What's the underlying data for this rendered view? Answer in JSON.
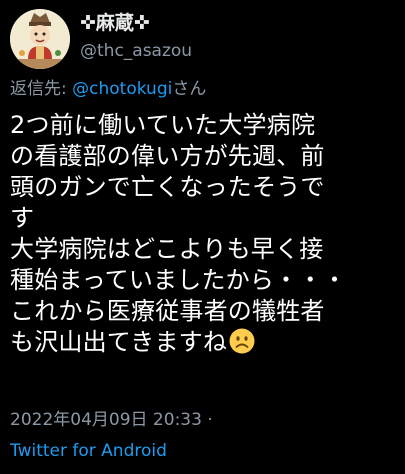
{
  "author": {
    "display_name": "✜麻蔵✜",
    "handle": "@thc_asazou",
    "avatar_icon": "cartoon-character-avatar-icon"
  },
  "reply": {
    "prefix": "返信先: ",
    "mention": "@chotokugi",
    "suffix": "さん"
  },
  "tweet": {
    "lines": [
      "2つ前に働いていた大学病院",
      "の看護部の偉い方が先週、前",
      "頭のガンで亡くなったそうで",
      "す",
      "大学病院はどこよりも早く接",
      "種始まっていましたから・・・",
      "これから医療従事者の犠牲者",
      "も沢山出てきますね"
    ],
    "emoji": "slightly-frowning-face-icon"
  },
  "meta": {
    "timestamp": "2022年04月09日 20:33 ·",
    "source": "Twitter for Android"
  },
  "colors": {
    "background": "#000000",
    "text": "#ffffff",
    "muted": "#8b98a5",
    "link": "#1d9bf0"
  }
}
